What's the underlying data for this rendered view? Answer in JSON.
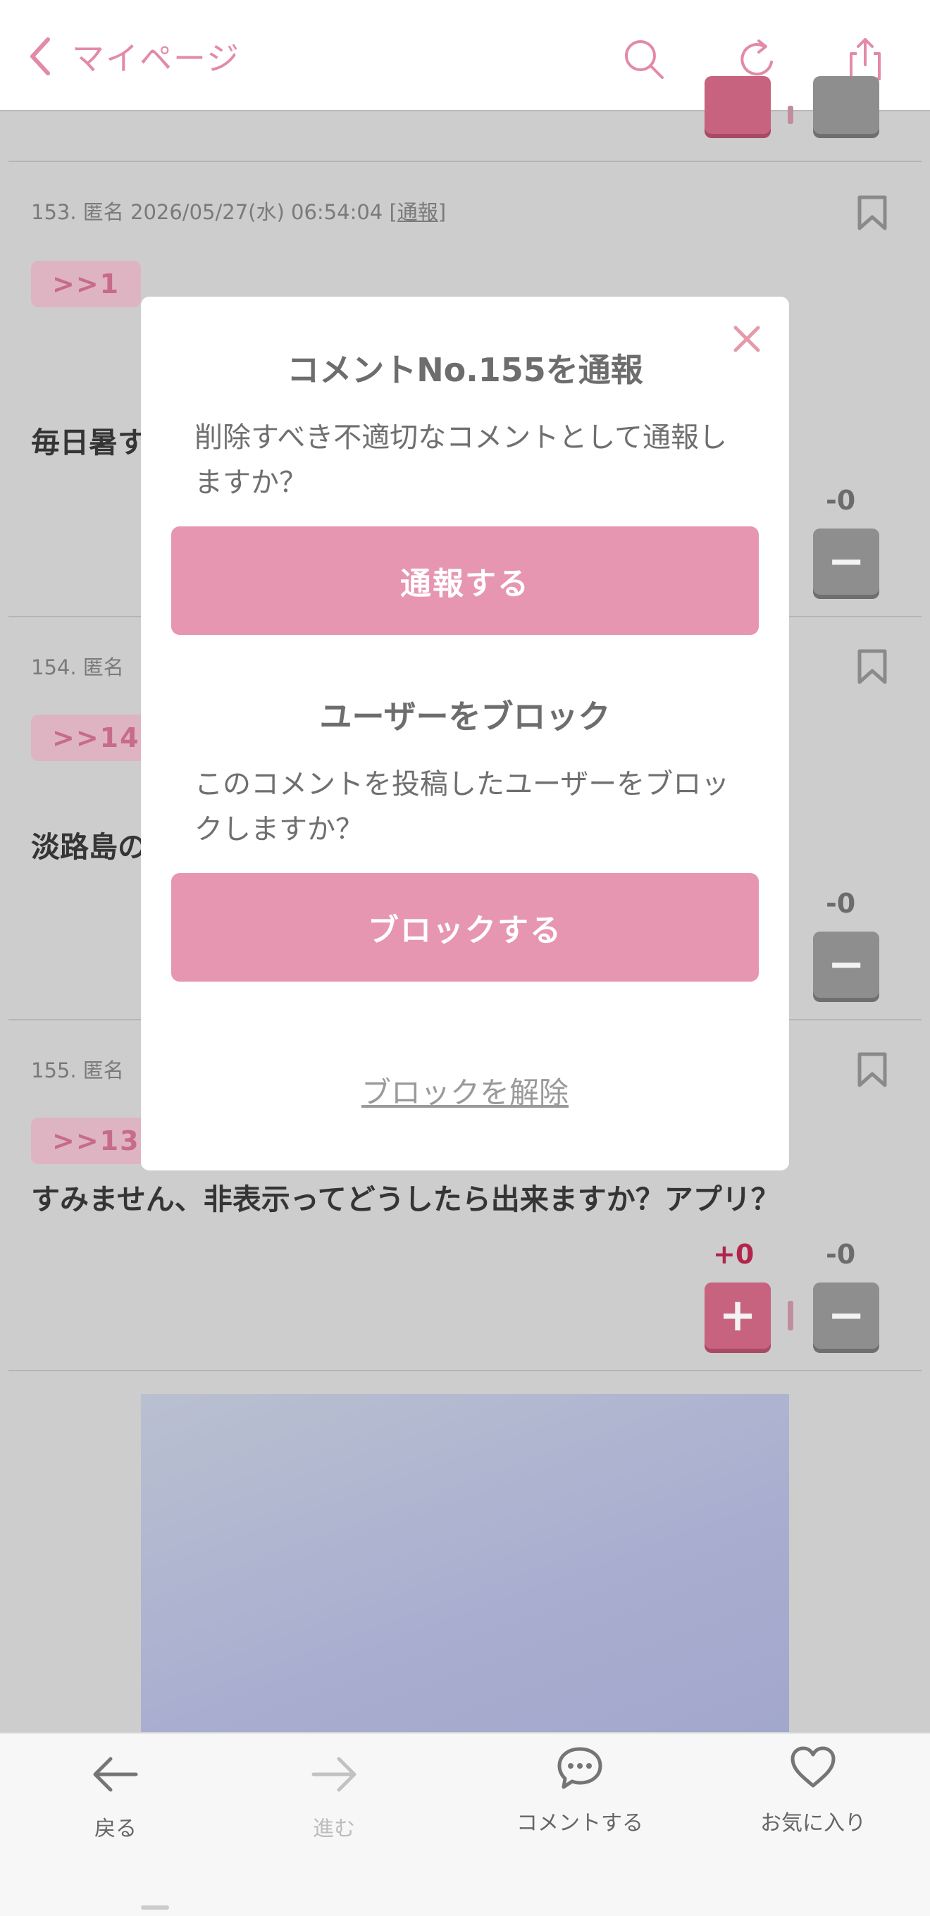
{
  "header": {
    "back_label": "マイページ",
    "icons": [
      "chevron-left-icon",
      "search-icon",
      "reload-icon",
      "share-icon"
    ],
    "accent_color": "#e28aa6"
  },
  "comments": [
    {
      "meta": "153. 匿名 2026/05/27(水) 06:54:04 [",
      "report_link": "通報",
      "meta_end": "]",
      "anchor": ">>1",
      "text": "毎日暑す",
      "minus": "-0"
    },
    {
      "meta": "154. 匿名",
      "anchor": ">>147",
      "text": "淡路島の",
      "minus": "-0"
    },
    {
      "meta": "155. 匿名",
      "anchor": ">>130",
      "text": "すみません、非表示ってどうしたら出来ますか？アプリ？",
      "plus": "+0",
      "minus": "-0"
    }
  ],
  "vote": {
    "plus_symbol": "+",
    "minus_symbol": "−"
  },
  "modal": {
    "report_title": "コメントNo.155を通報",
    "report_desc": "削除すべき不適切なコメントとして通報しますか？",
    "report_button": "通報する",
    "block_title": "ユーザーをブロック",
    "block_desc": "このコメントを投稿したユーザーをブロックしますか？",
    "block_button": "ブロックする",
    "unblock_link": "ブロックを解除",
    "button_color": "#e696b0"
  },
  "bottom_nav": {
    "back": "戻る",
    "forward": "進む",
    "comment": "コメントする",
    "favorite": "お気に入り"
  }
}
